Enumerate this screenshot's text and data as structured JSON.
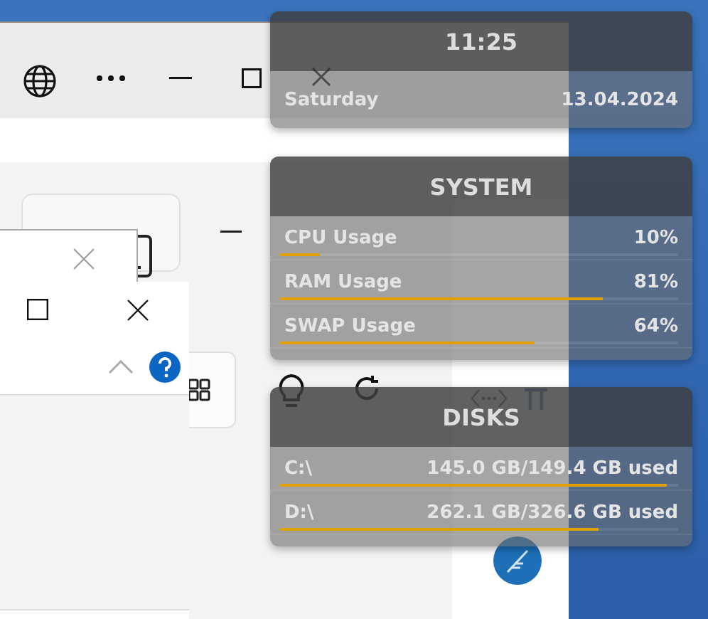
{
  "clock": {
    "time": "11:25",
    "day": "Saturday",
    "date": "13.04.2024"
  },
  "system": {
    "title": "SYSTEM",
    "rows": [
      {
        "label": "CPU Usage",
        "value": "10%",
        "level": 0.1
      },
      {
        "label": "RAM Usage",
        "value": "81%",
        "level": 0.81
      },
      {
        "label": "SWAP Usage",
        "value": "64%",
        "level": 0.64
      }
    ]
  },
  "disks": {
    "title": "DISKS",
    "rows": [
      {
        "label": "C:\\",
        "value": "145.0 GB/149.4 GB used",
        "level": 0.97
      },
      {
        "label": "D:\\",
        "value": "262.1 GB/326.6 GB used",
        "level": 0.8
      }
    ]
  }
}
